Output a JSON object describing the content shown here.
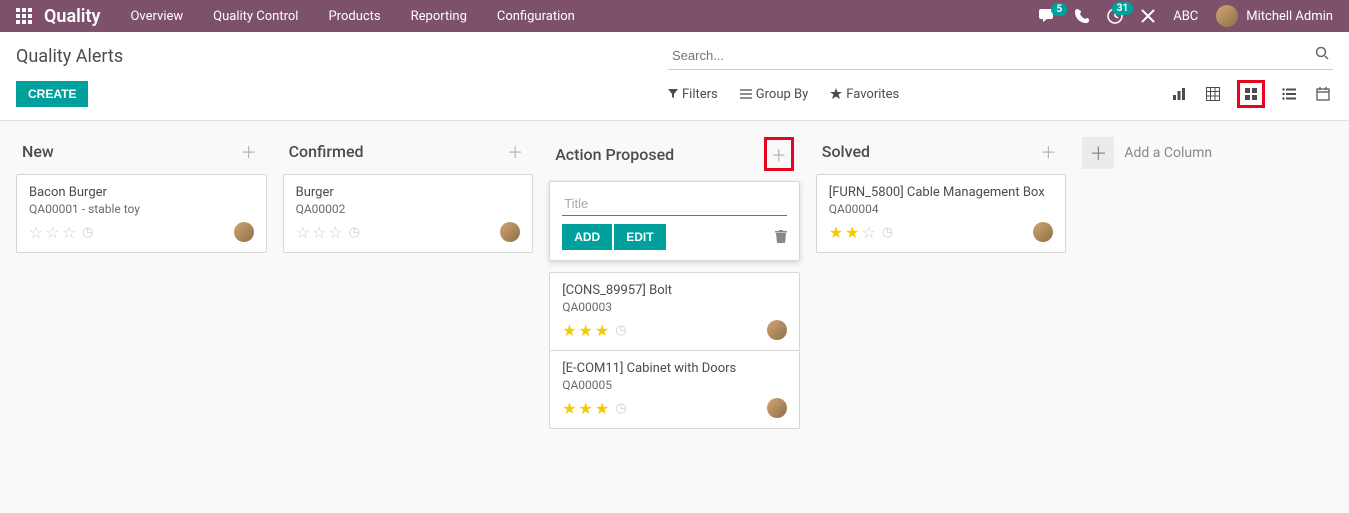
{
  "nav": {
    "brand": "Quality",
    "links": [
      "Overview",
      "Quality Control",
      "Products",
      "Reporting",
      "Configuration"
    ],
    "chat_badge": "5",
    "activity_badge": "31",
    "company": "ABC",
    "user": "Mitchell Admin"
  },
  "page": {
    "title": "Quality Alerts",
    "create_label": "CREATE",
    "search_placeholder": "Search..."
  },
  "toolbar": {
    "filters": "Filters",
    "groupby": "Group By",
    "favorites": "Favorites"
  },
  "kanban": {
    "columns": [
      {
        "title": "New",
        "cards": [
          {
            "title": "Bacon Burger",
            "ref": "QA00001 - stable toy",
            "stars": 0,
            "has_avatar": true
          }
        ]
      },
      {
        "title": "Confirmed",
        "cards": [
          {
            "title": "Burger",
            "ref": "QA00002",
            "stars": 0,
            "has_avatar": true
          }
        ]
      },
      {
        "title": "Action Proposed",
        "quick_create": {
          "placeholder": "Title",
          "add_label": "ADD",
          "edit_label": "EDIT"
        },
        "highlight_add": true,
        "cards": [
          {
            "title": "[CONS_89957] Bolt",
            "ref": "QA00003",
            "stars": 3,
            "has_avatar": true
          },
          {
            "title": "[E-COM11] Cabinet with Doors",
            "ref": "QA00005",
            "stars": 3,
            "has_avatar": true
          }
        ]
      },
      {
        "title": "Solved",
        "cards": [
          {
            "title": "[FURN_5800] Cable Management Box",
            "ref": "QA00004",
            "stars": 2,
            "has_avatar": true
          }
        ]
      }
    ],
    "add_column_label": "Add a Column"
  }
}
